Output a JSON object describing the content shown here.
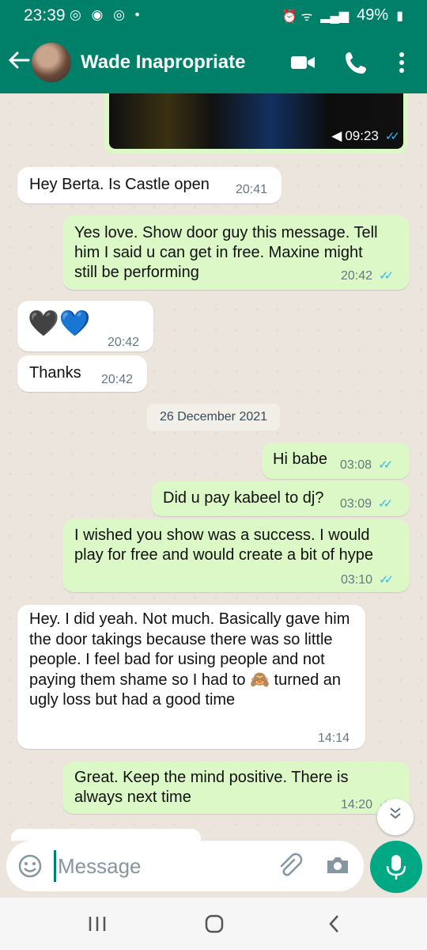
{
  "status_bar": {
    "time": "23:39",
    "battery": "49%",
    "left_icons": "◎ ◉ ◎ •",
    "right_icons": "⏰ ᯤ"
  },
  "header": {
    "contact_name": "Wade Inapropriate"
  },
  "colors": {
    "header": "#008069",
    "outgoing": "#dcf8c6",
    "incoming": "#ffffff",
    "ticks": "#34b7f1",
    "mic": "#00a884"
  },
  "icons": {
    "back": "arrow-left",
    "video": "video-camera",
    "call": "phone",
    "more": "vertical-dots",
    "emoji": "smiley",
    "attach": "paperclip",
    "camera": "camera",
    "mic": "microphone",
    "scroll": "double-chevron-down"
  },
  "messages": [
    {
      "dir": "out",
      "type": "media",
      "time": "09:23"
    },
    {
      "dir": "in",
      "text": "Hey Berta. Is Castle open",
      "time": "20:41"
    },
    {
      "dir": "out",
      "text": "Yes love. Show door guy this message. Tell him I said u can get in free. Maxine might still be performing",
      "time": "20:42"
    },
    {
      "dir": "in",
      "text": "🖤💙",
      "time": "20:42"
    },
    {
      "dir": "in",
      "text": "Thanks",
      "time": "20:42"
    },
    {
      "dir": "out",
      "text": "Hi babe",
      "time": "03:08"
    },
    {
      "dir": "out",
      "text": "Did u pay kabeel to dj?",
      "time": "03:09"
    },
    {
      "dir": "out",
      "text": "I wished you show was a success. I would play for free and would create a bit of hype",
      "time": "03:10"
    },
    {
      "dir": "in",
      "text": "Hey. I did yeah. Not much. Basically gave him the door takings because there was so little people. I feel bad for using people and not paying them shame so I had to 🙈 turned an ugly loss but had a good time",
      "time": "14:14"
    },
    {
      "dir": "out",
      "text": "Great. Keep the mind positive. There is always next time",
      "time": "14:20"
    }
  ],
  "date_divider": "26 December 2021",
  "composer": {
    "placeholder": "Message"
  }
}
